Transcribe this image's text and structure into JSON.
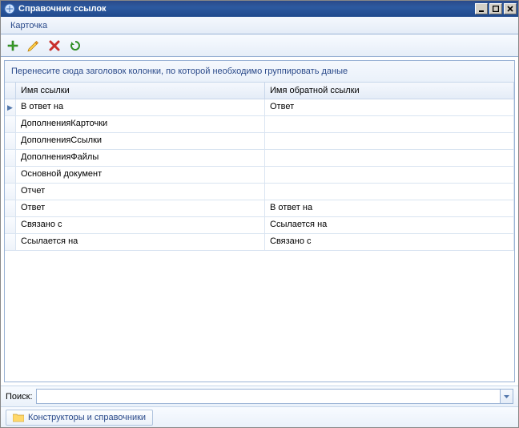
{
  "window": {
    "title": "Справочник ссылок"
  },
  "menu": {
    "item0": "Карточка"
  },
  "grid": {
    "group_hint": "Перенесите сюда заголовок колонки, по которой необходимо группировать даные",
    "columns": {
      "c0": "Имя ссылки",
      "c1": "Имя обратной ссылки"
    },
    "current_indicator": "▶",
    "rows": [
      {
        "c0": "В ответ на",
        "c1": "Ответ",
        "current": true
      },
      {
        "c0": "ДополненияКарточки",
        "c1": ""
      },
      {
        "c0": "ДополненияСсылки",
        "c1": ""
      },
      {
        "c0": "ДополненияФайлы",
        "c1": ""
      },
      {
        "c0": "Основной документ",
        "c1": ""
      },
      {
        "c0": "Отчет",
        "c1": ""
      },
      {
        "c0": "Ответ",
        "c1": "В ответ на"
      },
      {
        "c0": "Связано с",
        "c1": "Ссылается на"
      },
      {
        "c0": "Ссылается на",
        "c1": "Связано с"
      }
    ]
  },
  "search": {
    "label": "Поиск:",
    "value": ""
  },
  "footer": {
    "button0": "Конструкторы и справочники"
  }
}
